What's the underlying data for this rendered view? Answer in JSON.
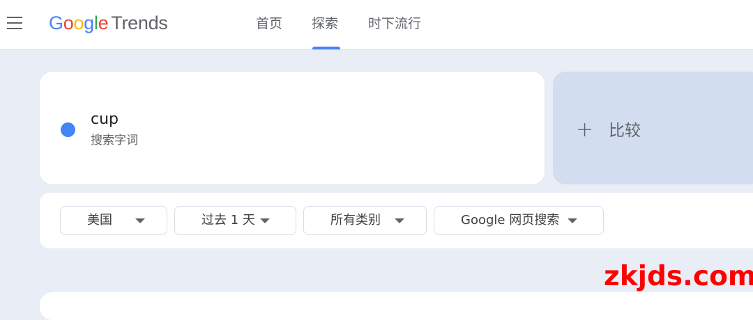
{
  "header": {
    "logo": {
      "letters": [
        "G",
        "o",
        "o",
        "g",
        "l",
        "e"
      ],
      "letter_colors": [
        "#4285f4",
        "#ea4335",
        "#fbbc05",
        "#4285f4",
        "#34a853",
        "#ea4335"
      ],
      "product": "Trends"
    },
    "nav": [
      {
        "label": "首页"
      },
      {
        "label": "探索",
        "active": true
      },
      {
        "label": "时下流行"
      }
    ],
    "accent_color": "#4285f4"
  },
  "search_term": {
    "name": "cup",
    "type": "搜索字词",
    "dot_color": "#4285f4"
  },
  "compare": {
    "icon": "plus-icon",
    "label": "比较"
  },
  "filters": {
    "region": "美国",
    "time_range": "过去 1 天",
    "category": "所有类别",
    "property": "Google 网页搜索",
    "icon": "caret-down-icon"
  },
  "watermark": "zkjds.com"
}
